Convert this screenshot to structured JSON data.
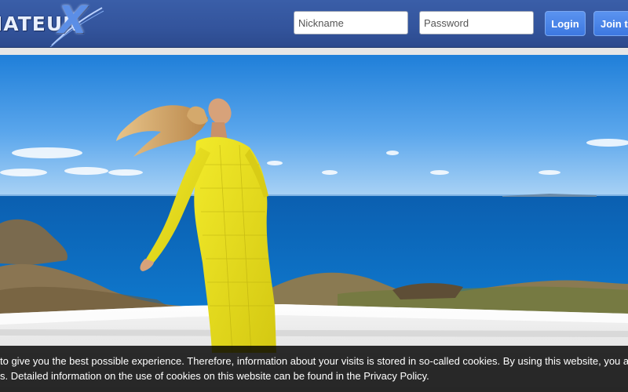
{
  "header": {
    "logo": {
      "text": "IATEUR",
      "mark": "X",
      "icon": "logo-x-swoosh"
    },
    "nickname_placeholder": "Nickname",
    "password_placeholder": "Password",
    "login_label": "Login",
    "join_label": "Join t",
    "colors": {
      "bar": "#33549c",
      "button": "#4a86ea"
    }
  },
  "hero": {
    "image": "woman-in-yellow-dress-on-terrace-above-sea"
  },
  "cookie_banner": {
    "line1": "to give you the best possible experience. Therefore, information about your visits is stored in so-called cookies. By using this website, you a",
    "line2": "s. Detailed information on the use of cookies on this website can be found in the Privacy Policy."
  }
}
